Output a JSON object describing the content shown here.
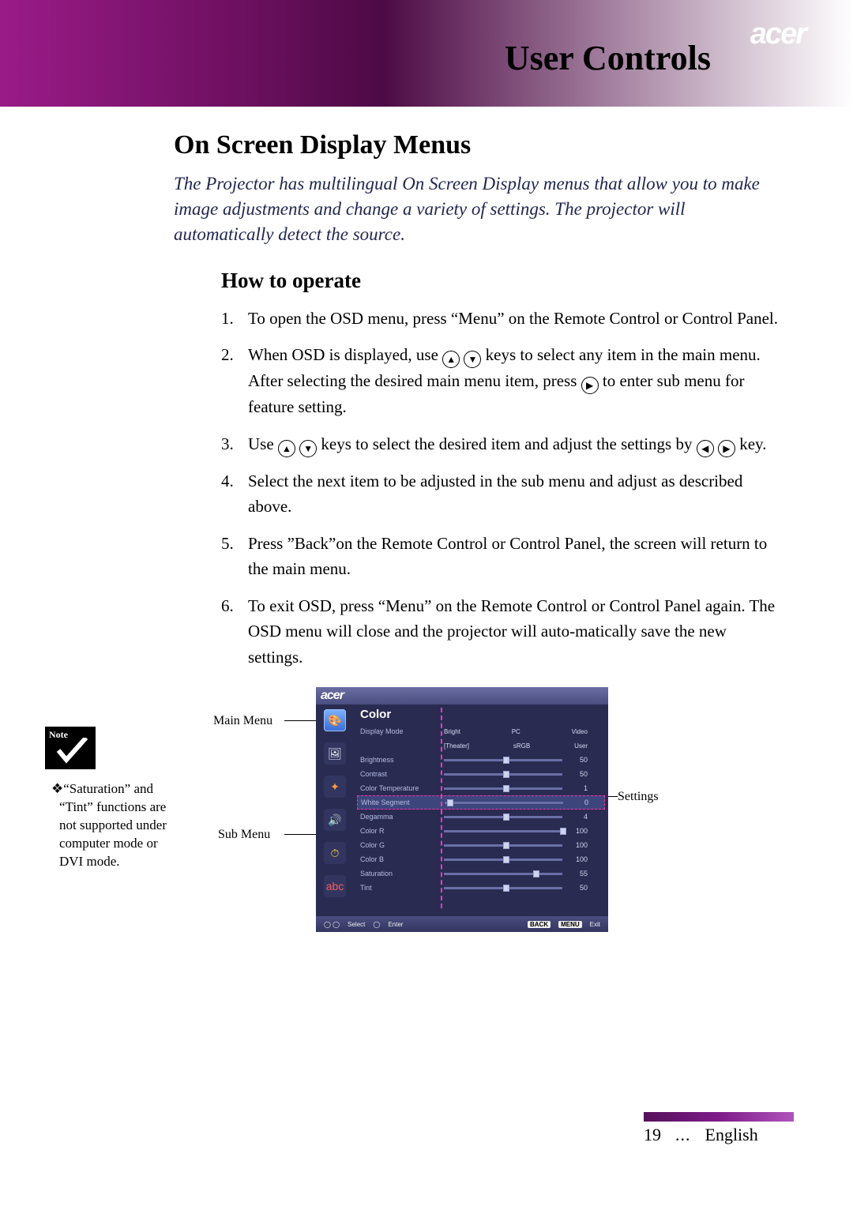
{
  "brand": "acer",
  "chapter_title": "User Controls",
  "section_title": "On Screen Display Menus",
  "intro": "The Projector has multilingual On Screen Display menus that allow you to make image adjustments and change a variety of settings. The projector will automatically detect the source.",
  "subsection_title": "How to operate",
  "steps": {
    "s1": {
      "num": "1.",
      "text": "To open the OSD menu, press “Menu” on the Remote Control or Control Panel."
    },
    "s2": {
      "num": "2.",
      "pre": "When OSD is displayed, use ",
      "mid": " keys to select any item in the main menu. After selecting the desired main menu item, press ",
      "post": " to enter sub menu for feature setting."
    },
    "s3": {
      "num": "3.",
      "pre": "Use ",
      "mid": " keys to select the desired item and adjust the settings by ",
      "post": "  key."
    },
    "s4": {
      "num": "4.",
      "text": "Select the next item to be adjusted in the sub menu and adjust as described above."
    },
    "s5": {
      "num": "5.",
      "text": "Press ”Back”on the Remote Control or Control Panel, the screen will return to the main menu."
    },
    "s6": {
      "num": "6.",
      "text": "To exit OSD, press “Menu” on the Remote Control or Control Panel again. The OSD menu will close and the projector will auto-matically save the new settings."
    }
  },
  "side_note": {
    "badge": "Note",
    "text": "“Saturation” and “Tint” functions are not supported under computer mode or DVI mode."
  },
  "figure": {
    "main_menu_label": "Main Menu",
    "sub_menu_label": "Sub Menu",
    "settings_label": "Settings"
  },
  "osd": {
    "brand": "acer",
    "title": "Color",
    "display_mode_label": "Display Mode",
    "modes": {
      "bright": "Bright",
      "pc": "PC",
      "video": "Video",
      "theater": "[Theater]",
      "srgb": "sRGB",
      "user": "User"
    },
    "items": {
      "brightness": {
        "label": "Brightness",
        "value": "50",
        "pos": 50
      },
      "contrast": {
        "label": "Contrast",
        "value": "50",
        "pos": 50
      },
      "color_temp": {
        "label": "Color Temperature",
        "value": "1",
        "pos": 50
      },
      "white_segment": {
        "label": "White Segment",
        "value": "0",
        "pos": 2
      },
      "degamma": {
        "label": "Degamma",
        "value": "4",
        "pos": 50
      },
      "color_r": {
        "label": "Color R",
        "value": "100",
        "pos": 100
      },
      "color_g": {
        "label": "Color G",
        "value": "100",
        "pos": 50
      },
      "color_b": {
        "label": "Color B",
        "value": "100",
        "pos": 50
      },
      "saturation": {
        "label": "Saturation",
        "value": "55",
        "pos": 75
      },
      "tint": {
        "label": "Tint",
        "value": "50",
        "pos": 50
      }
    },
    "footer": {
      "select": "Select",
      "enter": "Enter",
      "back": "BACK",
      "menu": "MENU",
      "exit": "Exit"
    }
  },
  "footer": {
    "page": "19",
    "dots": "...",
    "lang": "English"
  }
}
